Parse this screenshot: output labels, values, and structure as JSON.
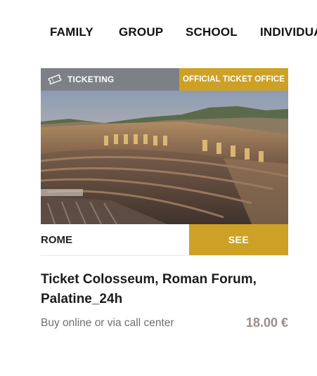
{
  "tabs": [
    "FAMILY",
    "GROUP",
    "SCHOOL",
    "INDIVIDUAL"
  ],
  "card": {
    "category_label": "TICKETING",
    "category_icon": "ticket-icon",
    "badge_label": "OFFICIAL TICKET OFFICE",
    "image_alt": "Colosseum interior",
    "location": "ROME",
    "see_label": "SEE",
    "title": "Ticket Colosseum, Roman Forum, Palatine_24h",
    "subtitle": "Buy online or via call center",
    "price": "18.00 €"
  },
  "colors": {
    "accent": "#cda125",
    "category_bg": "#7e8088",
    "price": "#9a8f8a"
  }
}
